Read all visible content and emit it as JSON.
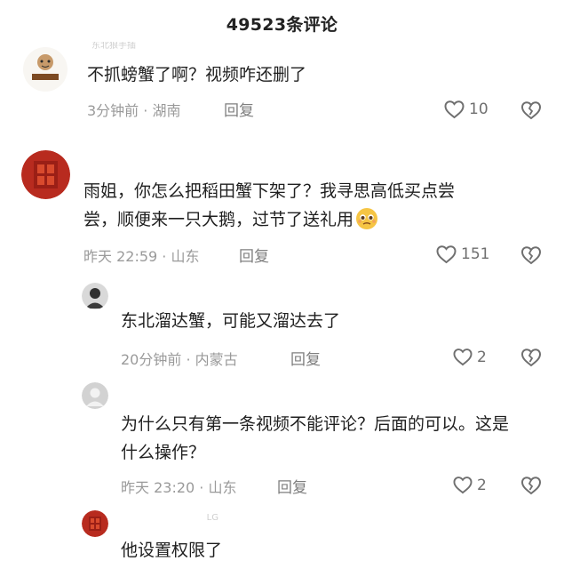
{
  "header": {
    "title": "49523条评论"
  },
  "comments": [
    {
      "username": "东北狼手插",
      "text": "不抓螃蟹了啊？视频咋还删了",
      "meta": "3分钟前 · 湖南",
      "reply_label": "回复",
      "likes": "10"
    },
    {
      "username": "",
      "text": "雨姐，你怎么把稻田蟹下架了？我寻思高低买点尝尝，顺便来一只大鹅，过节了送礼用",
      "meta": "昨天 22:59 · 山东",
      "reply_label": "回复",
      "likes": "151"
    },
    {
      "username": "",
      "text": "东北溜达蟹，可能又溜达去了",
      "meta": "20分钟前 · 内蒙古",
      "reply_label": "回复",
      "likes": "2"
    },
    {
      "username": "",
      "text": "为什么只有第一条视频不能评论？后面的可以。这是什么操作？",
      "meta": "昨天 23:20 · 山东",
      "reply_label": "回复",
      "likes": "2"
    },
    {
      "username": "LG",
      "text": "他设置权限了"
    }
  ],
  "icons": {
    "like": "heart-outline-icon",
    "dislike": "broken-heart-icon",
    "emoji": "pleading-face-icon"
  },
  "colors": {
    "text": "#1f1f1f",
    "meta": "#9a9a9a",
    "reply": "#7f7f7f",
    "icon": "#6f6f6f",
    "avatar_red": "#b82b1f"
  }
}
